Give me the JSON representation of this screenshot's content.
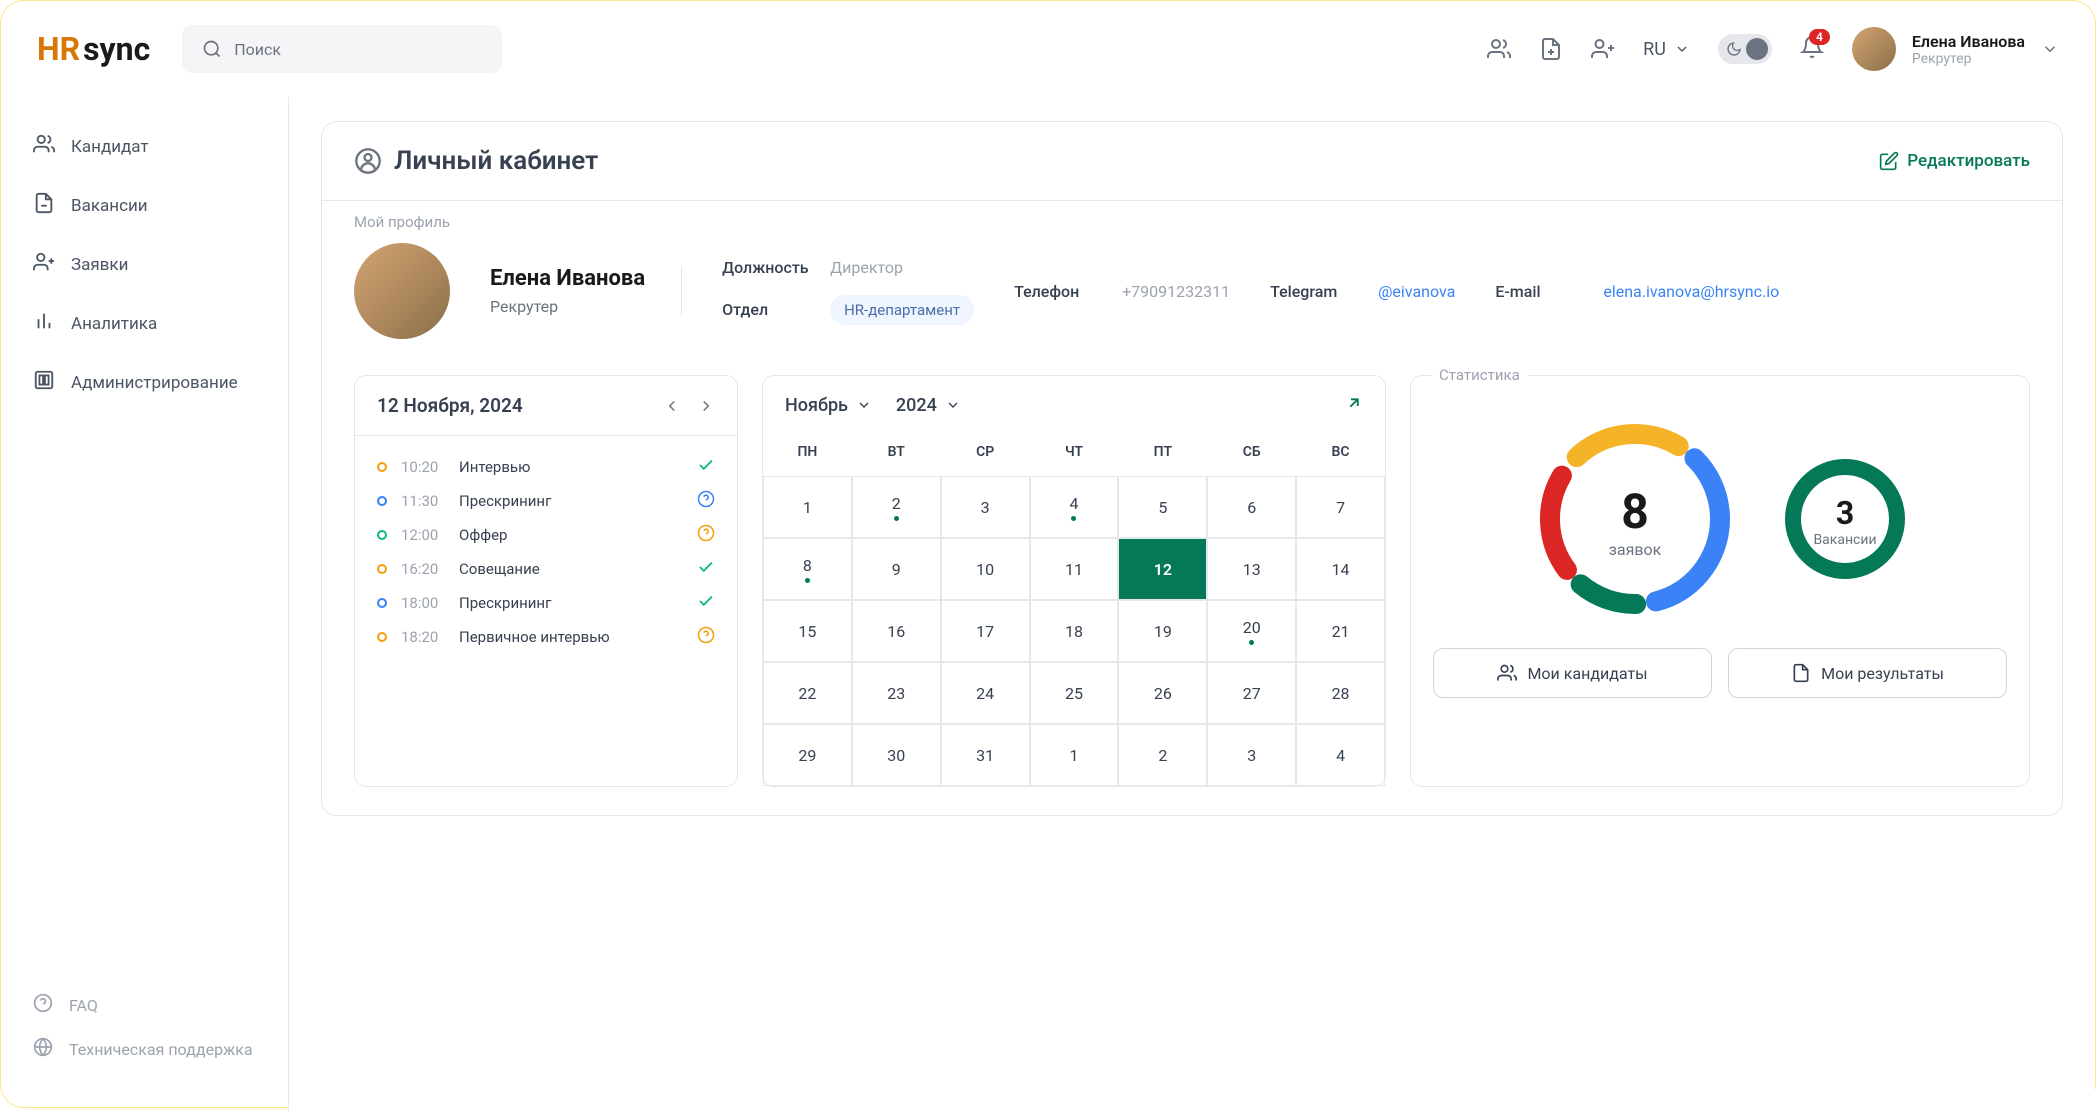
{
  "app": {
    "logo_a": "HR",
    "logo_b": "sync"
  },
  "search": {
    "placeholder": "Поиск"
  },
  "header": {
    "lang": "RU",
    "notif_count": "4",
    "user_name": "Елена Иванова",
    "user_role": "Рекрутер"
  },
  "sidebar": {
    "items": [
      {
        "label": "Кандидат"
      },
      {
        "label": "Вакансии"
      },
      {
        "label": "Заявки"
      },
      {
        "label": "Аналитика"
      },
      {
        "label": "Администрирование"
      }
    ],
    "footer": [
      {
        "label": "FAQ"
      },
      {
        "label": "Техническая поддержка"
      }
    ]
  },
  "page": {
    "title": "Личный кабинет",
    "edit": "Редактировать"
  },
  "profile": {
    "section_label": "Мой профиль",
    "name": "Елена Иванова",
    "role": "Рекрутер",
    "position_label": "Должность",
    "position_value": "Директор",
    "dept_label": "Отдел",
    "dept_value": "HR-департамент",
    "phone_label": "Телефон",
    "phone_value": "+79091232311",
    "tg_label": "Telegram",
    "tg_value": "@eivanova",
    "email_label": "E-mail",
    "email_value": "elena.ivanova@hrsync.io"
  },
  "agenda": {
    "date": "12 Ноября, 2024",
    "items": [
      {
        "time": "10:20",
        "title": "Интервью",
        "dot": "orange",
        "status": "check"
      },
      {
        "time": "11:30",
        "title": "Прескрининг",
        "dot": "blue",
        "status": "help-blue"
      },
      {
        "time": "12:00",
        "title": "Оффер",
        "dot": "green",
        "status": "help-orange"
      },
      {
        "time": "16:20",
        "title": "Совещание",
        "dot": "orange",
        "status": "check"
      },
      {
        "time": "18:00",
        "title": "Прескрининг",
        "dot": "blue",
        "status": "check"
      },
      {
        "time": "18:20",
        "title": "Первичное интервью",
        "dot": "orange",
        "status": "help-orange"
      }
    ]
  },
  "calendar": {
    "month": "Ноябрь",
    "year": "2024",
    "dow": [
      "ПН",
      "ВТ",
      "СР",
      "ЧТ",
      "ПТ",
      "СБ",
      "ВС"
    ],
    "days": [
      {
        "n": "1"
      },
      {
        "n": "2",
        "dot": true
      },
      {
        "n": "3"
      },
      {
        "n": "4",
        "dot": true
      },
      {
        "n": "5"
      },
      {
        "n": "6"
      },
      {
        "n": "7"
      },
      {
        "n": "8",
        "dot": true
      },
      {
        "n": "9"
      },
      {
        "n": "10"
      },
      {
        "n": "11"
      },
      {
        "n": "12",
        "today": true
      },
      {
        "n": "13"
      },
      {
        "n": "14"
      },
      {
        "n": "15"
      },
      {
        "n": "16"
      },
      {
        "n": "17"
      },
      {
        "n": "18"
      },
      {
        "n": "19"
      },
      {
        "n": "20",
        "dot": true
      },
      {
        "n": "21"
      },
      {
        "n": "22"
      },
      {
        "n": "23"
      },
      {
        "n": "24"
      },
      {
        "n": "25"
      },
      {
        "n": "26"
      },
      {
        "n": "27"
      },
      {
        "n": "28"
      },
      {
        "n": "29"
      },
      {
        "n": "30"
      },
      {
        "n": "31"
      },
      {
        "n": "1"
      },
      {
        "n": "2"
      },
      {
        "n": "3"
      },
      {
        "n": "4"
      }
    ]
  },
  "stats": {
    "label": "Статистика",
    "big_num": "8",
    "big_label": "заявок",
    "small_num": "3",
    "small_label": "Вакансии",
    "btn1": "Мои кандидаты",
    "btn2": "Мои результаты"
  },
  "chart_data": [
    {
      "type": "pie",
      "title": "заявок",
      "total": 8,
      "series": [
        {
          "name": "yellow",
          "color": "#f5b428",
          "value": 2
        },
        {
          "name": "blue",
          "color": "#3b82f6",
          "value": 3
        },
        {
          "name": "green",
          "color": "#047857",
          "value": 1
        },
        {
          "name": "red",
          "color": "#dc2626",
          "value": 2
        }
      ]
    },
    {
      "type": "pie",
      "title": "Вакансии",
      "total": 3,
      "series": [
        {
          "name": "green",
          "color": "#047857",
          "value": 3
        }
      ]
    }
  ]
}
